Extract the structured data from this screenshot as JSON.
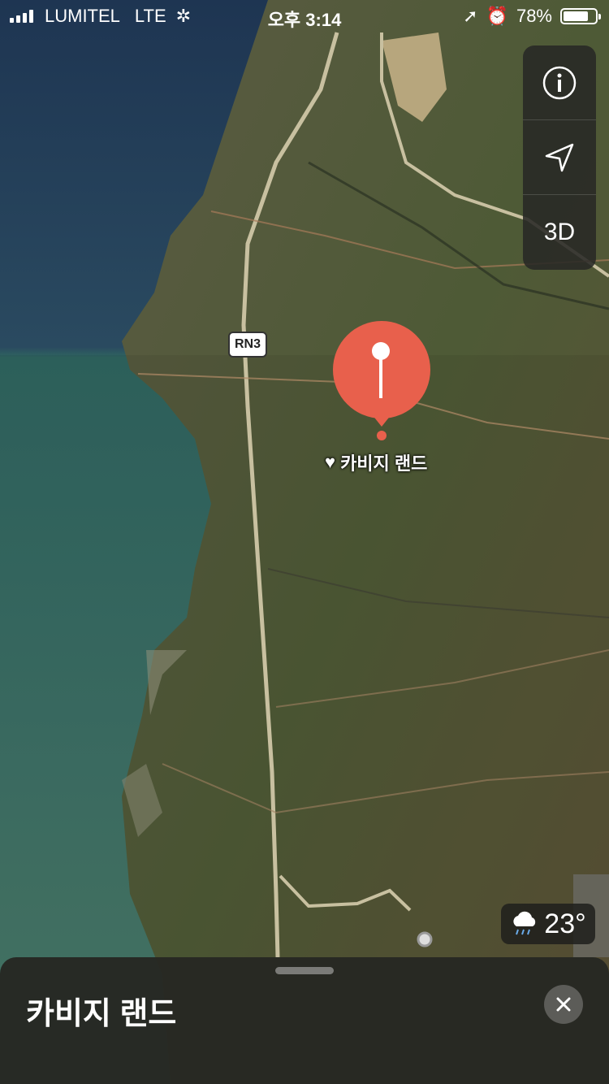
{
  "status_bar": {
    "carrier": "LUMITEL",
    "network": "LTE",
    "time": "오후 3:14",
    "battery_text": "78%",
    "battery_level": 0.78
  },
  "map": {
    "road_label": "RN3",
    "pin_label": "카비지 랜드",
    "pin_color": "#E8604C"
  },
  "controls": {
    "info_icon": "info-icon",
    "location_icon": "location-arrow-icon",
    "three_d_label": "3D"
  },
  "weather": {
    "icon": "rain-cloud-icon",
    "temperature": "23°"
  },
  "place_card": {
    "title": "카비지 랜드"
  }
}
